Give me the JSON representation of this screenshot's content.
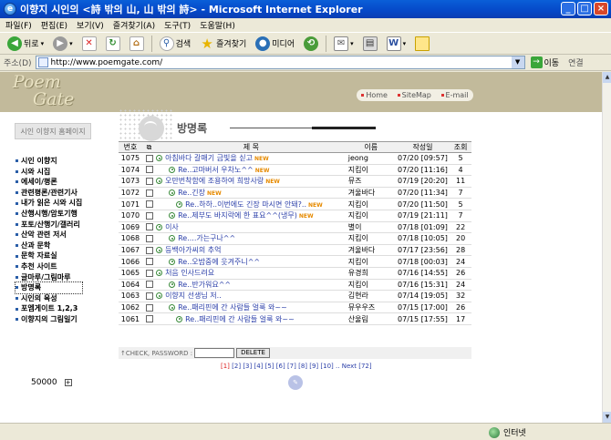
{
  "window": {
    "title": "이향지 시인의 <詩 밖의 山, 山 밖의 詩> - Microsoft Internet Explorer",
    "buttons": [
      "_",
      "□",
      "×"
    ]
  },
  "menubar": [
    "파일(F)",
    "편집(E)",
    "보기(V)",
    "즐겨찾기(A)",
    "도구(T)",
    "도움말(H)"
  ],
  "toolbar": {
    "back": "뒤로",
    "search": "검색",
    "favorites": "즐겨찾기",
    "media": "미디어"
  },
  "address": {
    "label": "주소(D)",
    "url": "http://www.poemgate.com/",
    "go": "이동",
    "links": "연결"
  },
  "site": {
    "logo_line1": "Poem",
    "logo_line2": "Gate",
    "nav": [
      "Home",
      "SiteMap",
      "E-mail"
    ],
    "home_button": "시인 이향지 홈페이지",
    "menu": [
      "시인 이향지",
      "시와 시집",
      "에세이/평론",
      "관련평론/관련기사",
      "내가 읽은 시와 시집",
      "산행시행/암토기행",
      "포토/산행기/갤러리",
      "산악 관련 저서",
      "산과 문학",
      "문학 자료실",
      "추천 사이트",
      "글마루/그림마루",
      "방명록",
      "시인의 육성",
      "포엠게이트 1,2,3",
      "이향지의 그림일기"
    ],
    "selected_menu": "방명록",
    "counter": "50000",
    "counter_btn": "+"
  },
  "board": {
    "title": "방명록",
    "headers": [
      "번호",
      "",
      "제 목",
      "이름",
      "작성일",
      "조회"
    ],
    "new_tag": "NEW",
    "rows": [
      {
        "no": "1075",
        "subject": "아침바다 갈매기 금빛을 싣고",
        "level": 0,
        "new": true,
        "name": "jeong",
        "date": "07/20 [09:57]",
        "hits": "5"
      },
      {
        "no": "1074",
        "subject": "Re..고마버서 우차노^^",
        "level": 1,
        "new": true,
        "name": "지킴이",
        "date": "07/20 [11:16]",
        "hits": "4"
      },
      {
        "no": "1073",
        "subject": "오만번착함에 조용하여 희망사랑",
        "level": 0,
        "new": true,
        "name": "뮤즈",
        "date": "07/19 [20:20]",
        "hits": "11"
      },
      {
        "no": "1072",
        "subject": "Re..긴장",
        "level": 1,
        "new": true,
        "name": "겨울바다",
        "date": "07/20 [11:34]",
        "hits": "7"
      },
      {
        "no": "1071",
        "subject": "Re..하하..이번에도 긴장 마시면 안돼?..",
        "level": 2,
        "new": true,
        "name": "지킴이",
        "date": "07/20 [11:50]",
        "hits": "5"
      },
      {
        "no": "1070",
        "subject": "Re..제부도 바지락에 한 표요^^(냉무)",
        "level": 1,
        "new": true,
        "name": "지킴이",
        "date": "07/19 [21:11]",
        "hits": "7"
      },
      {
        "no": "1069",
        "subject": "이사",
        "level": 0,
        "new": false,
        "name": "별이",
        "date": "07/18 [01:09]",
        "hits": "22"
      },
      {
        "no": "1068",
        "subject": "Re....가는구나^^",
        "level": 1,
        "new": false,
        "name": "지킴이",
        "date": "07/18 [10:05]",
        "hits": "20"
      },
      {
        "no": "1067",
        "subject": "등백아가씨의 추억",
        "level": 0,
        "new": false,
        "name": "겨울바다",
        "date": "07/17 [23:56]",
        "hits": "28"
      },
      {
        "no": "1066",
        "subject": "Re..오밤중에 웃겨주니^^",
        "level": 1,
        "new": false,
        "name": "지킴이",
        "date": "07/18 [00:03]",
        "hits": "24"
      },
      {
        "no": "1065",
        "subject": "처음 인사드려요",
        "level": 0,
        "new": false,
        "name": "유경희",
        "date": "07/16 [14:55]",
        "hits": "26"
      },
      {
        "no": "1064",
        "subject": "Re..반가워요^^",
        "level": 1,
        "new": false,
        "name": "지킴이",
        "date": "07/16 [15:31]",
        "hits": "24"
      },
      {
        "no": "1063",
        "subject": "이향지 선생님 저..",
        "level": 0,
        "new": false,
        "name": "김현라",
        "date": "07/14 [19:05]",
        "hits": "32"
      },
      {
        "no": "1062",
        "subject": "Re..패리핀에 간 사람들 얼룩 와~~",
        "level": 1,
        "new": false,
        "name": "뮤우우즈",
        "date": "07/15 [17:00]",
        "hits": "26"
      },
      {
        "no": "1061",
        "subject": "Re..패리핀에 간 사람들 얼룩 와~~",
        "level": 2,
        "new": false,
        "name": "산울림",
        "date": "07/15 [17:55]",
        "hits": "17"
      }
    ],
    "password_label": "↑CHECK, PASSWORD :",
    "delete_button": "DELETE",
    "pager": {
      "current": "[1]",
      "pages": [
        "[2]",
        "[3]",
        "[4]",
        "[5]",
        "[6]",
        "[7]",
        "[8]",
        "[9]",
        "[10]",
        "..",
        "Next",
        "[72]"
      ]
    }
  },
  "status": {
    "zone": "인터넷"
  }
}
